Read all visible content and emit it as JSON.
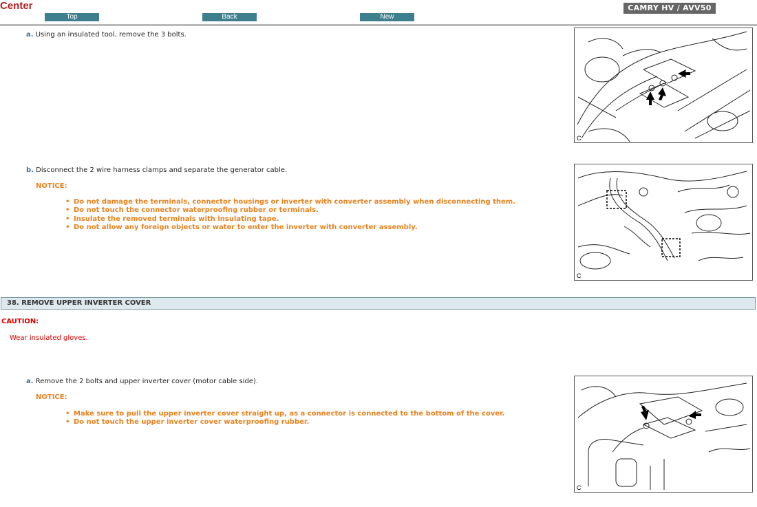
{
  "header": {
    "brand": "Center",
    "nav": {
      "top": "Top",
      "back": "Back",
      "new": "New"
    },
    "model": "CAMRY HV / AVV50"
  },
  "step_a1": {
    "label": "a.",
    "text": "Using an insulated tool, remove the 3 bolts."
  },
  "step_b": {
    "label": "b.",
    "text": "Disconnect the 2 wire harness clamps and separate the generator cable.",
    "notice_heading": "NOTICE:",
    "notices": [
      "Do not damage the terminals, connector housings or inverter with converter assembly when disconnecting them.",
      "Do not touch the connector waterproofing rubber or terminals.",
      "Insulate the removed terminals with insulating tape.",
      "Do not allow any foreign objects or water to enter the inverter with converter assembly."
    ]
  },
  "section38": {
    "title": "38. REMOVE UPPER INVERTER COVER",
    "caution_heading": "CAUTION:",
    "caution_text": "Wear insulated gloves."
  },
  "step_a2": {
    "label": "a.",
    "text": "Remove the 2 bolts and upper inverter cover (motor cable side).",
    "notice_heading": "NOTICE:",
    "notices": [
      "Make sure to pull the upper inverter cover straight up, as a connector is connected to the bottom of the cover.",
      "Do not touch the upper inverter cover waterproofing rubber."
    ]
  },
  "figures": {
    "fig1_code": "C",
    "fig2_code": "C",
    "fig3_code": "C"
  },
  "colors": {
    "brand": "#b22222",
    "nav_button": "#3d7f8c",
    "notice": "#e8821e",
    "caution": "#e00000",
    "section_bg": "#dde9ef"
  }
}
